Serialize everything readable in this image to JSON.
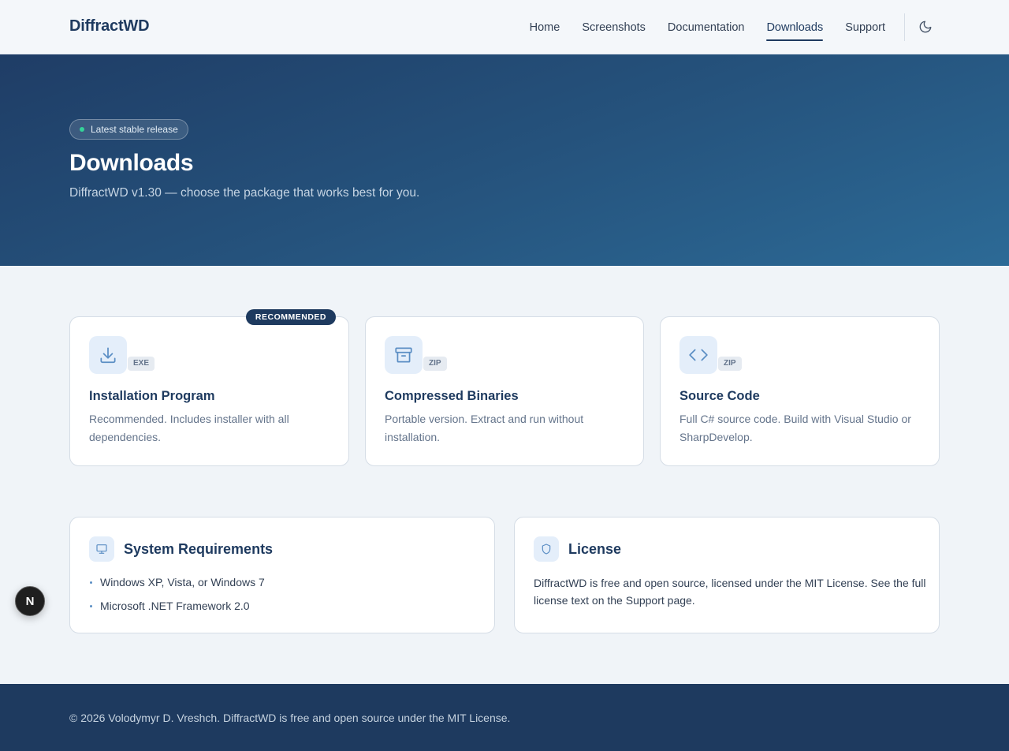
{
  "header": {
    "brand": "DiffractWD",
    "nav": [
      "Home",
      "Screenshots",
      "Documentation",
      "Downloads",
      "Support"
    ],
    "active_nav": "Downloads",
    "theme_icon": "moon-icon"
  },
  "hero": {
    "badge": "Latest stable release",
    "title": "Downloads",
    "subtitle": "DiffractWD v1.30 — choose the package that works best for you."
  },
  "downloads": [
    {
      "icon": "download-icon",
      "ext": "EXE",
      "title": "Installation Program",
      "description": "Recommended. Includes installer with all dependencies.",
      "ribbon": "RECOMMENDED"
    },
    {
      "icon": "archive-icon",
      "ext": "ZIP",
      "title": "Compressed Binaries",
      "description": "Portable version. Extract and run without installation."
    },
    {
      "icon": "code-icon",
      "ext": "ZIP",
      "title": "Source Code",
      "description": "Full C# source code. Build with Visual Studio or SharpDevelop."
    }
  ],
  "requirements": {
    "icon": "monitor-icon",
    "title": "System Requirements",
    "items": [
      "Windows XP, Vista, or Windows 7",
      "Microsoft .NET Framework 2.0"
    ]
  },
  "license": {
    "icon": "shield-icon",
    "title": "License",
    "text": "DiffractWD is free and open source, licensed under the MIT License. See the full license text on the Support page."
  },
  "fab": {
    "label": "N"
  },
  "footer": {
    "text": "© 2026 Volodymyr D. Vreshch. DiffractWD is free and open source under the MIT License."
  },
  "colors": {
    "primary": "#1e3a5f",
    "accent_icon": "#5b8ec4",
    "badge_dot": "#34d399"
  }
}
